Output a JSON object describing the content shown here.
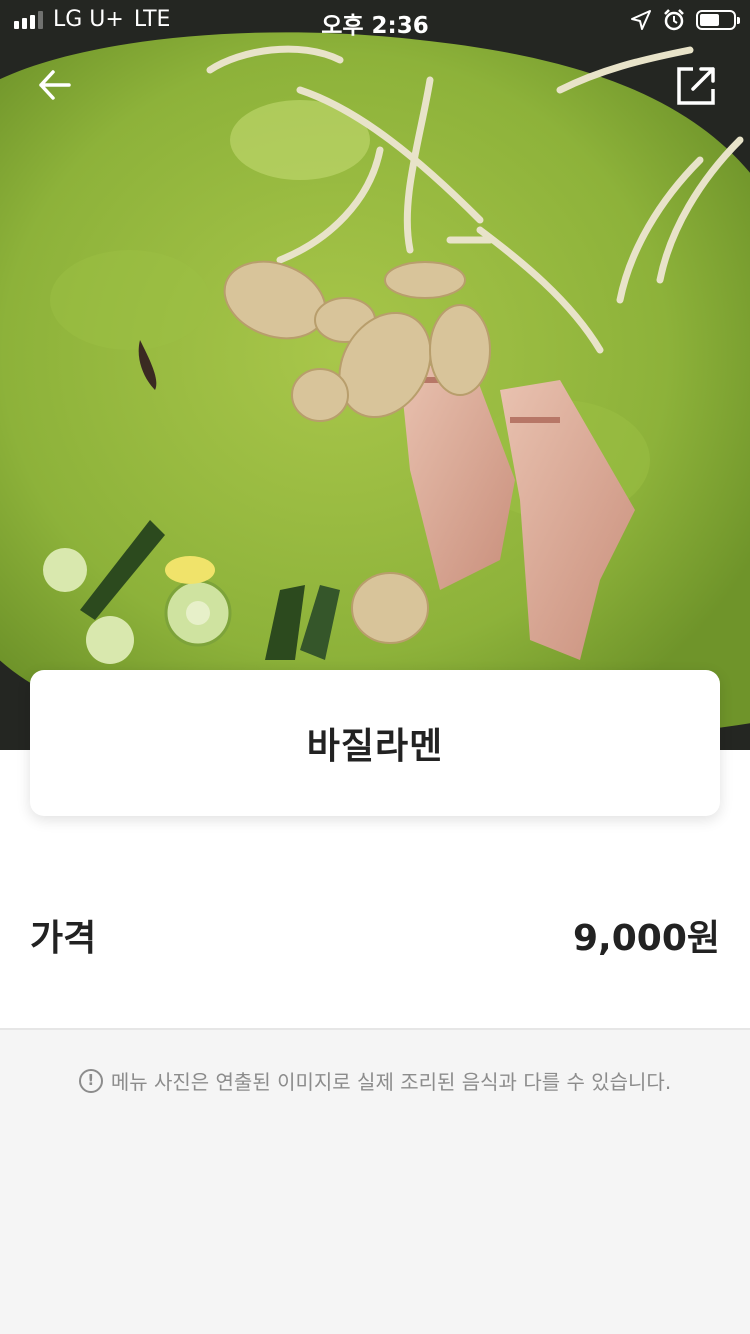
{
  "status_bar": {
    "carrier": "LG U+",
    "network": "LTE",
    "time": "오후 2:36",
    "battery_level": 0.6
  },
  "nav": {
    "back_icon": "arrow-left-icon",
    "share_icon": "share-icon"
  },
  "menu": {
    "name": "바질라멘",
    "price_label": "가격",
    "price_value": "9,000원"
  },
  "notice": {
    "icon": "info-icon",
    "text": "메뉴 사진은 연출된 이미지로 실제 조리된 음식과 다를 수 있습니다."
  },
  "colors": {
    "broth": "#8fb43a",
    "background": "#f5f5f5",
    "text": "#222222",
    "muted": "#8c8c8c"
  }
}
